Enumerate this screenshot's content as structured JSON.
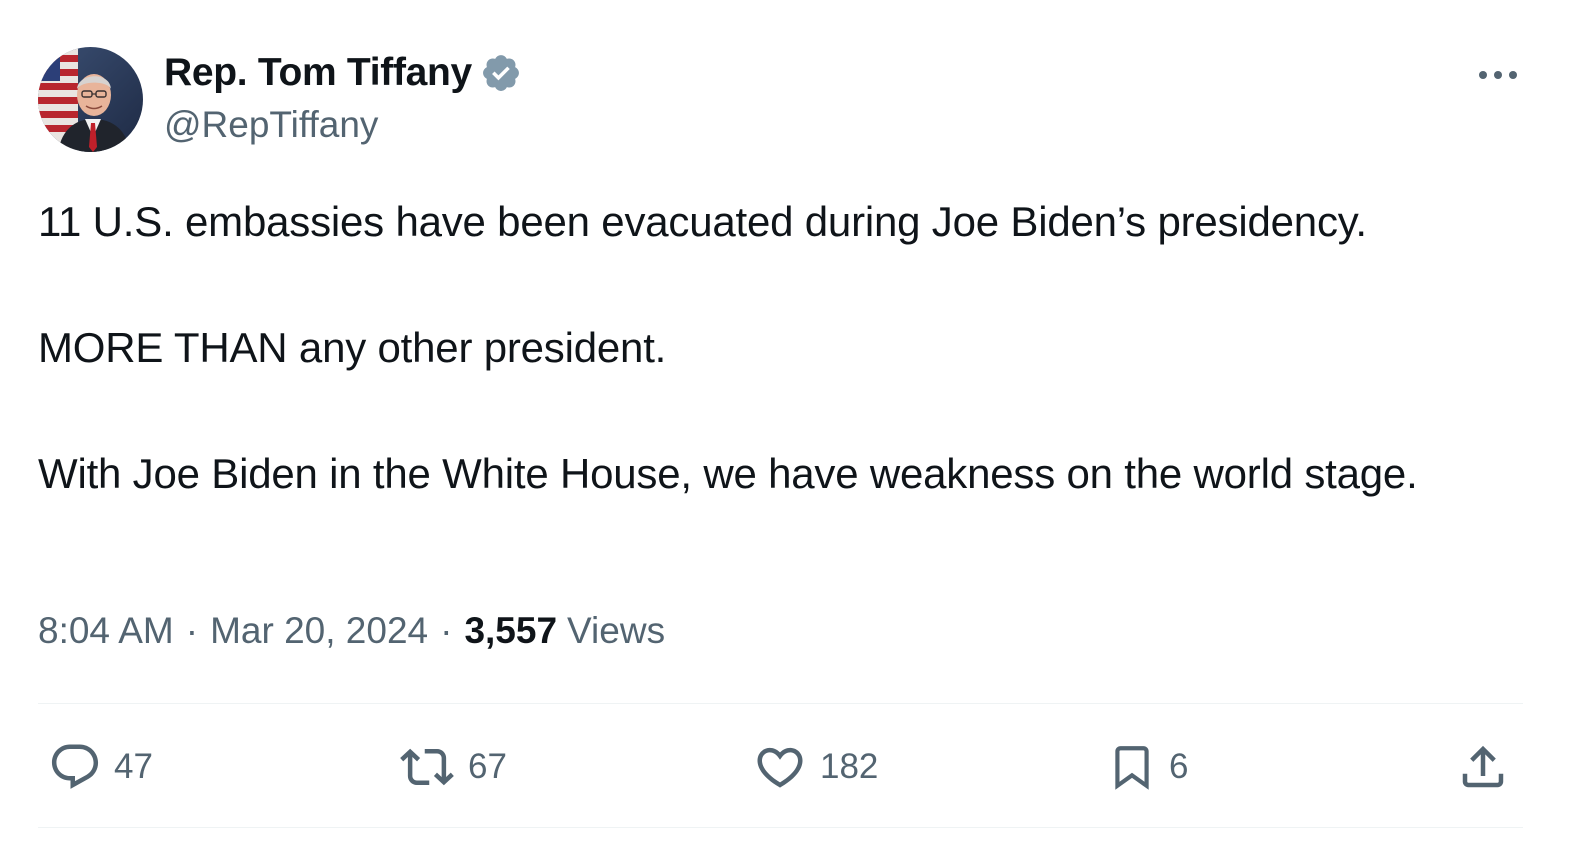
{
  "author": {
    "display_name": "Rep. Tom Tiffany",
    "handle": "@RepTiffany",
    "verified_icon": "verified-badge-icon"
  },
  "tweet": {
    "paragraphs": [
      "11 U.S. embassies have been evacuated during Joe Biden’s presidency.",
      "MORE THAN any other president.",
      "With Joe Biden in the White House, we have weakness on the world stage."
    ],
    "time": "8:04 AM",
    "date": "Mar 20, 2024",
    "separator": "·",
    "views_count": "3,557",
    "views_label": "Views"
  },
  "actions": {
    "replies": "47",
    "reposts": "67",
    "likes": "182",
    "bookmarks": "6"
  },
  "colors": {
    "text_primary": "#0f1419",
    "text_secondary": "#536471",
    "divider": "#eff3f4",
    "verified_badge": "#829aab"
  }
}
